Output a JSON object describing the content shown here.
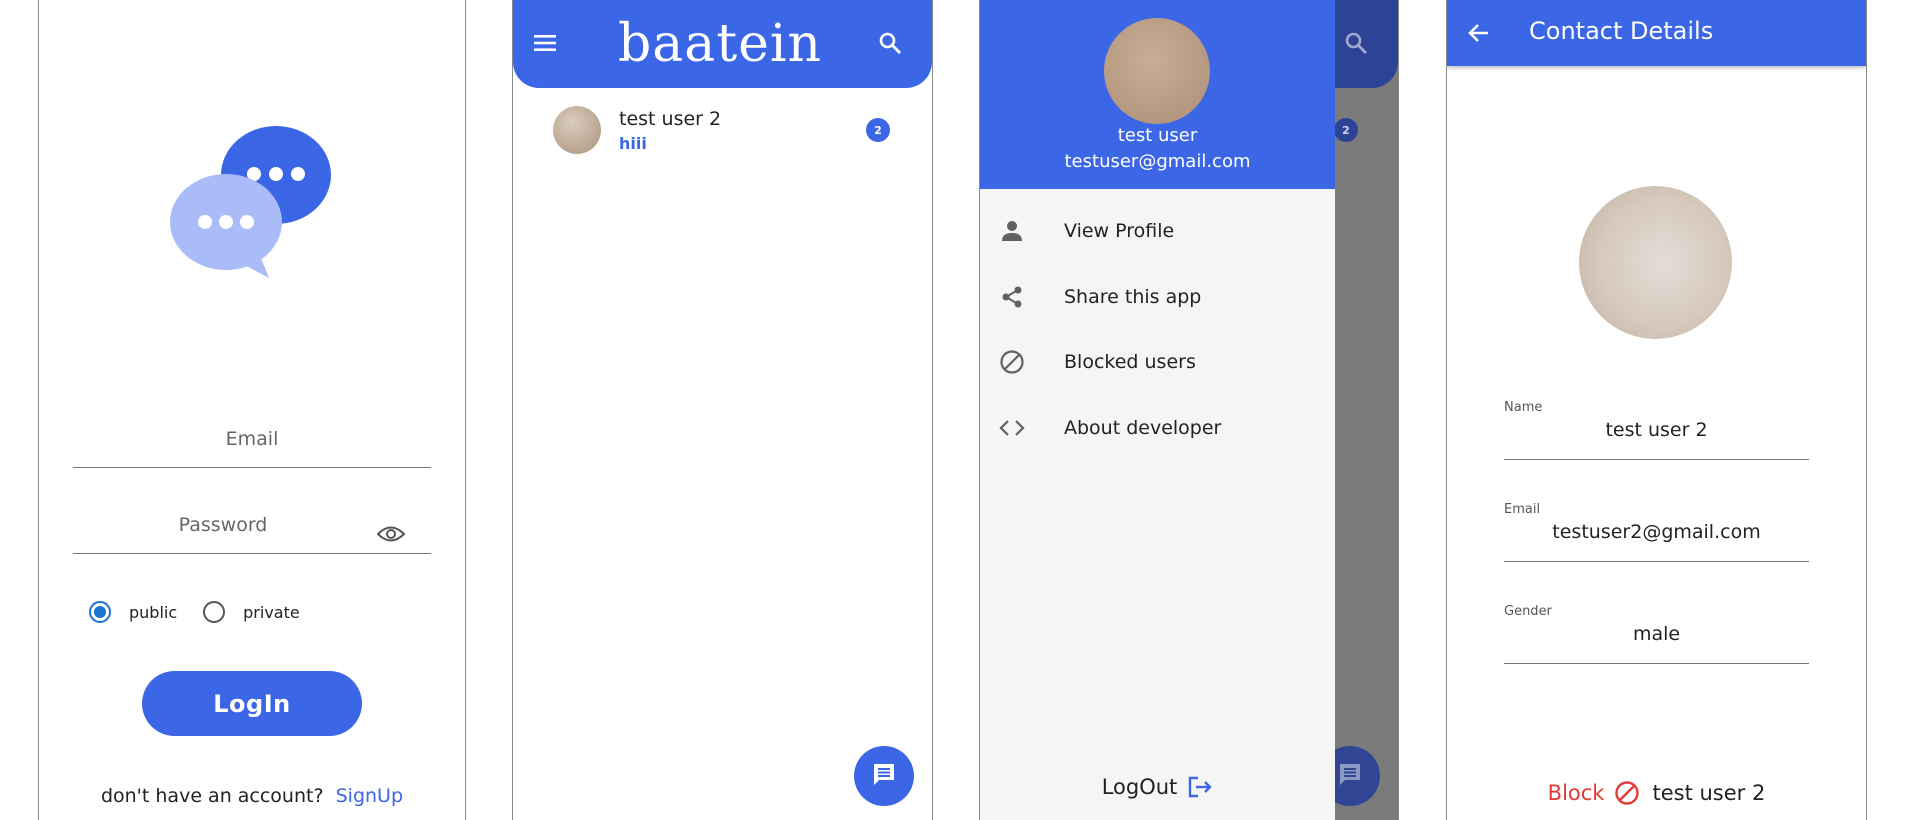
{
  "login": {
    "email_placeholder": "Email",
    "password_placeholder": "Password",
    "radio_options": [
      "public",
      "private"
    ],
    "selected_option": "public",
    "login_label": "LogIn",
    "signup_prompt": "don't have an account?",
    "signup_link": "SignUp"
  },
  "chats": {
    "brand": "baatein",
    "items": [
      {
        "name": "test user 2",
        "last_message": "hiii",
        "unread": "2"
      }
    ]
  },
  "drawer": {
    "user_name": "test user",
    "user_email": "testuser@gmail.com",
    "menu": [
      {
        "label": "View Profile",
        "icon": "person-icon"
      },
      {
        "label": "Share this app",
        "icon": "share-icon"
      },
      {
        "label": "Blocked users",
        "icon": "block-icon"
      },
      {
        "label": "About developer",
        "icon": "code-icon"
      }
    ],
    "logout_label": "LogOut",
    "background_badge": "2"
  },
  "contact": {
    "title": "Contact Details",
    "fields": [
      {
        "label": "Name",
        "value": "test user 2"
      },
      {
        "label": "Email",
        "value": "testuser2@gmail.com"
      },
      {
        "label": "Gender",
        "value": "male"
      }
    ],
    "block_label": "Block",
    "block_user": "test user 2"
  },
  "colors": {
    "primary": "#3b66e6",
    "light_primary": "#a9bcf7",
    "danger": "#e53935",
    "radio_selected": "#1976d2"
  }
}
